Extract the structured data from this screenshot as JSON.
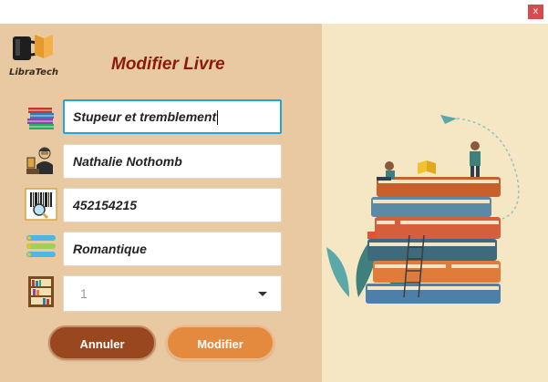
{
  "window": {
    "close_label": "x"
  },
  "logo": {
    "text": "LibraTech"
  },
  "form": {
    "title": "Modifier Livre",
    "fields": {
      "title_value": "Stupeur et tremblement",
      "author_value": "Nathalie Nothomb",
      "isbn_value": "452154215",
      "genre_value": "Romantique",
      "shelf_value": "1"
    }
  },
  "buttons": {
    "cancel_label": "Annuler",
    "modify_label": "Modifier"
  },
  "colors": {
    "left_panel": "#e8c9a1",
    "right_panel": "#f6e7c4",
    "title_color": "#8b1a0c",
    "cancel_button": "#98471e",
    "modify_button": "#e48a3f",
    "focus_border": "#1fa6de"
  },
  "icons": {
    "logo": "mug-book-logo-icon",
    "title_field": "book-stack-icon",
    "author_field": "author-reading-icon",
    "isbn_field": "barcode-magnifier-icon",
    "genre_field": "list-icon",
    "shelf_field": "bookshelf-icon"
  }
}
